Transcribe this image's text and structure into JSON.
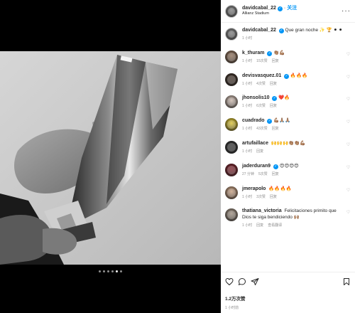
{
  "post": {
    "author": "davidcabal_22",
    "follow_label": "关注",
    "location": "Allianz Stadium",
    "likes": "1.2万次赞",
    "date": "1 小时前",
    "media_page_count": 6,
    "media_active_index": 4
  },
  "caption": {
    "user": "davidcabal_22",
    "text": "Que gran noche ✨ 🏆 ⚫ ⚫",
    "time": "1 小时"
  },
  "comments": [
    {
      "user": "k_thuram",
      "verified": true,
      "text": "👏🏽💪🏽",
      "time": "1 小时",
      "likes": "15次赞",
      "reply": "",
      "avatar_color": "#8a6a52"
    },
    {
      "user": "devisvasquez.01",
      "verified": true,
      "text": "🔥🔥🔥",
      "time": "1 小时",
      "likes": "4次赞",
      "reply": "",
      "avatar_color": "#3a2a20"
    },
    {
      "user": "jhonsolis10",
      "verified": true,
      "text": "❤️🔥",
      "time": "1 小时",
      "likes": "6次赞",
      "reply": "",
      "avatar_color": "#c8b4a8"
    },
    {
      "user": "cuadrado",
      "verified": true,
      "text": "💪🏽🙏🏽🙏🏽",
      "time": "1 小时",
      "likes": "43次赞",
      "reply": "",
      "avatar_color": "#d9c027"
    },
    {
      "user": "artufaillace",
      "verified": false,
      "text": "🙌🙌🙌👏🏽👏🏽💪🏽",
      "time": "1 小时",
      "likes": "",
      "reply": "",
      "avatar_color": "#2c2c2c"
    },
    {
      "user": "jaderduran9",
      "verified": true,
      "text": "😍😍😍😍",
      "time": "27 分钟",
      "likes": "5次赞",
      "reply": "",
      "avatar_color": "#7a1a24"
    },
    {
      "user": "jmerapolo",
      "verified": false,
      "text": "🔥🔥🔥🔥",
      "time": "1 小时",
      "likes": "3次赞",
      "reply": "",
      "avatar_color": "#c49a7a"
    },
    {
      "user": "thatiana_victoria",
      "verified": false,
      "text": "Felicitaciones primito que Dios te siga bendiciendo 🙌🏽",
      "time": "1 小时",
      "likes": "",
      "reply": "查看翻译",
      "avatar_color": "#9a8a7a"
    }
  ],
  "colors": {
    "accent": "#0095f6",
    "muted": "#8e8e8e",
    "text": "#262626"
  },
  "icons": [
    "heart-icon",
    "comment-icon",
    "share-icon",
    "bookmark-icon",
    "more-icon",
    "verified-icon"
  ]
}
